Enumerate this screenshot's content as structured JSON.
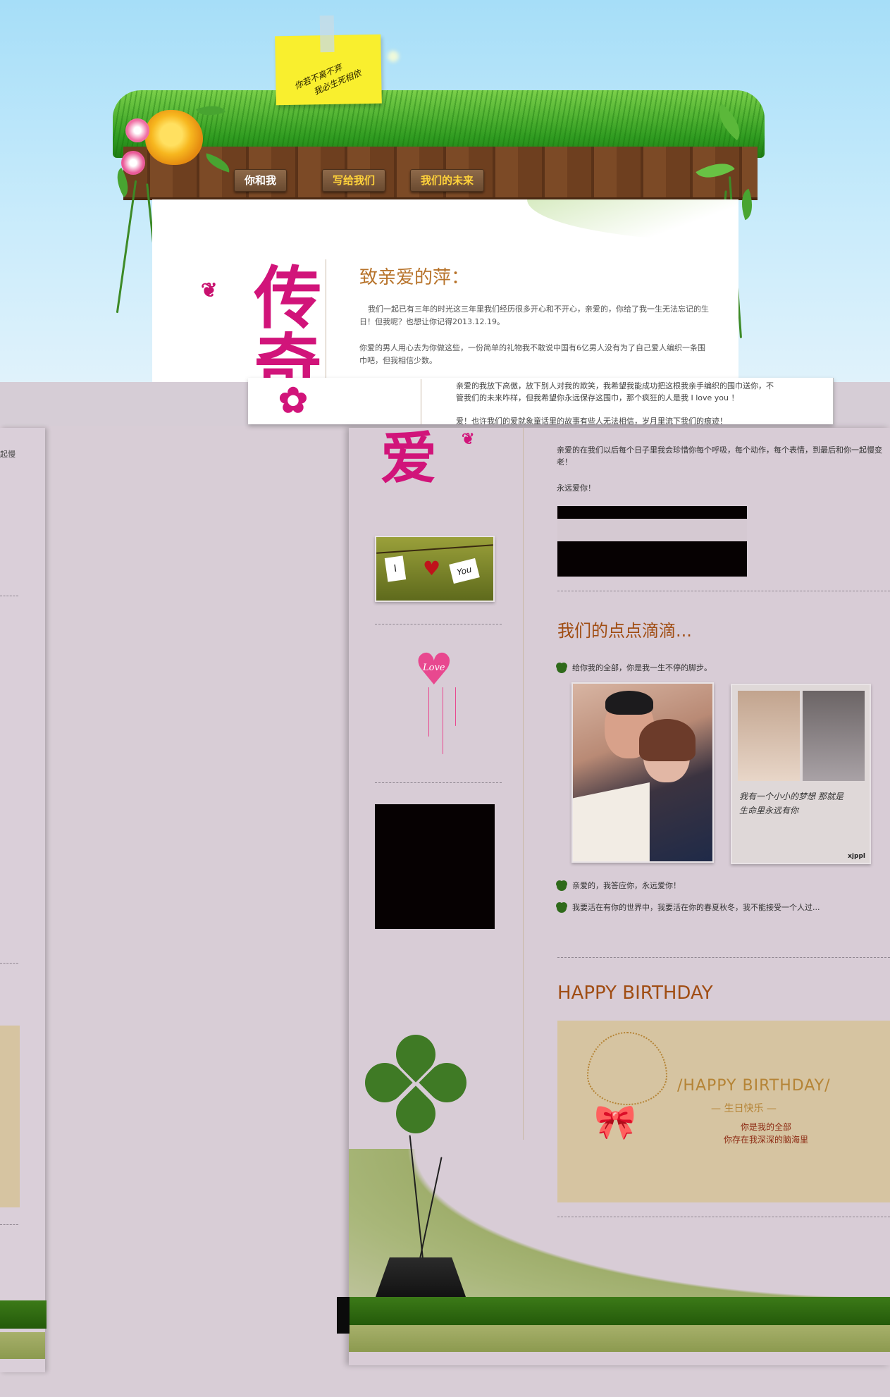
{
  "note": {
    "line1": "你若不离不弃",
    "line2": "我必生死相依"
  },
  "nav": [
    {
      "label": "你和我"
    },
    {
      "label": "写给我们"
    },
    {
      "label": "我们的未来"
    }
  ],
  "top_page": {
    "title": "致亲爱的萍：",
    "para1": "我们一起已有三年的时光这三年里我们经历很多开心和不开心，亲爱的，你给了我一生无法忘记的生日！但我呢？也想让你记得2013.12.19。",
    "para2": "你爱的男人用心去为你做这些，一份简单的礼物我不敢说中国有6亿男人没有为了自己爱人编织一条围巾吧，但我相信少数。",
    "deco_text": "传奇"
  },
  "strip": {
    "line1": "亲爱的我放下高傲，放下别人对我的欺笑，我希望我能成功把这根我亲手编织的围巾送你，不",
    "line2": "管我们的未来咋样，但我希望你永远保存这围巾，那个疯狂的人是我 I love you ！",
    "line3": "爱！也许我们的爱就象童话里的故事有些人无法相信，岁月里流下我们的痕迹！",
    "left_fragment": "起慢"
  },
  "main": {
    "para1": "亲爱的在我们以后每个日子里我会珍惜你每个呼吸，每个动作，每个表情，到最后和你一起慢变老！",
    "forever": "永远爱你！",
    "section1_title": "我们的点点滴滴...",
    "bullets": [
      {
        "text": "给你我的全部，你是我一生不停的脚步。"
      },
      {
        "text": "亲爱的，我答应你，永远爱你！"
      },
      {
        "text": "我要活在有你的世界中，我要活在你的春夏秋冬，我不能接受一个人过..."
      }
    ],
    "section2_title": "HAPPY BIRTHDAY",
    "birthday_card": {
      "headline": "/HAPPY BIRTHDAY/",
      "sub": "生日快乐",
      "line1": "你是我的全部",
      "line2": "你存在我深深的脑海里"
    },
    "side_deco": {
      "love_tag": "Love",
      "photo_i": "I",
      "photo_you": "You",
      "pink_text": "爱"
    },
    "photo2_caption": "我有一个小小的梦想 那就是 生命里永远有你",
    "photo2_watermark": "xjppl"
  },
  "colors": {
    "sky": "#a6def8",
    "title_orange": "#b7732a",
    "section_brown": "#a04d13",
    "panel_lilac": "#d8ccd6",
    "grass": "#2f9b20",
    "wood": "#6b3e1f",
    "nav_gold": "#ffd23a",
    "pink_accent": "#d1147a"
  }
}
